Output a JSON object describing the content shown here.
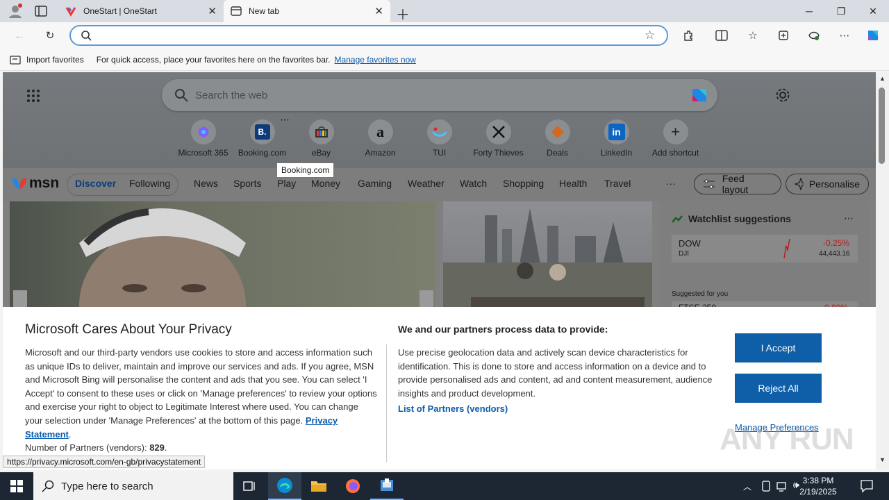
{
  "browser": {
    "tabs": [
      {
        "label": "OneStart | OneStart"
      },
      {
        "label": "New tab"
      }
    ],
    "address_value": "",
    "favorites_bar": {
      "import_label": "Import favorites",
      "hint": "For quick access, place your favorites here on the favorites bar.",
      "manage_link": "Manage favorites now"
    }
  },
  "newtab": {
    "search_placeholder": "Search the web",
    "shortcuts": [
      {
        "label": "Microsoft 365",
        "icon": "microsoft365-icon"
      },
      {
        "label": "Booking.com",
        "icon": "booking-icon"
      },
      {
        "label": "eBay",
        "icon": "ebay-icon"
      },
      {
        "label": "Amazon",
        "icon": "amazon-icon"
      },
      {
        "label": "TUI",
        "icon": "tui-icon"
      },
      {
        "label": "Forty Thieves",
        "icon": "swords-icon"
      },
      {
        "label": "Deals",
        "icon": "deals-icon"
      },
      {
        "label": "LinkedIn",
        "icon": "linkedin-icon"
      },
      {
        "label": "Add shortcut",
        "icon": "plus-icon"
      }
    ],
    "tooltip": "Booking.com",
    "msn_logo": "msn",
    "nav": {
      "discover": "Discover",
      "following": "Following",
      "items": [
        "News",
        "Sports",
        "Play",
        "Money",
        "Gaming",
        "Weather",
        "Watch",
        "Shopping",
        "Health",
        "Travel"
      ],
      "more": "···",
      "feed_layout": "Feed layout",
      "personalise": "Personalise"
    },
    "watchlist": {
      "title": "Watchlist suggestions",
      "stock_symbol": "DOW",
      "stock_sub": "DJI",
      "stock_change": "-0.25%",
      "stock_value": "44,443.16",
      "suggested": "Suggested for you",
      "next_symbol": "FTSE 250",
      "next_change": "-0.60%"
    }
  },
  "privacy": {
    "title": "Microsoft Cares About Your Privacy",
    "body": "Microsoft and our third-party vendors use cookies to store and access information such as unique IDs to deliver, maintain and improve our services and ads. If you agree, MSN and Microsoft Bing will personalise the content and ads that you see. You can select 'I Accept' to consent to these uses or click on 'Manage preferences' to review your options and exercise your right to object to Legitimate Interest where used.  You can change your selection under 'Manage Preferences' at the bottom of this page.",
    "privacy_link": "Privacy Statement",
    "partners_label": "Number of Partners (vendors):",
    "partners_count": "829",
    "right_title": "We and our partners process data to provide:",
    "right_body": "Use precise geolocation data and actively scan device characteristics for identification. This is done to store and access information on a device and to provide personalised ads and content, ad and content measurement, audience insights and product development.",
    "partners_link": "List of Partners (vendors)",
    "accept": "I Accept",
    "reject": "Reject All",
    "manage": "Manage Preferences"
  },
  "status_url": "https://privacy.microsoft.com/en-gb/privacystatement",
  "watermark": "ANY RUN",
  "taskbar": {
    "search_placeholder": "Type here to search",
    "time": "3:38 PM",
    "date": "2/19/2025"
  },
  "colors": {
    "accent": "#0f5ea8",
    "link": "#0b5cad",
    "taskbar": "#1c2733"
  }
}
